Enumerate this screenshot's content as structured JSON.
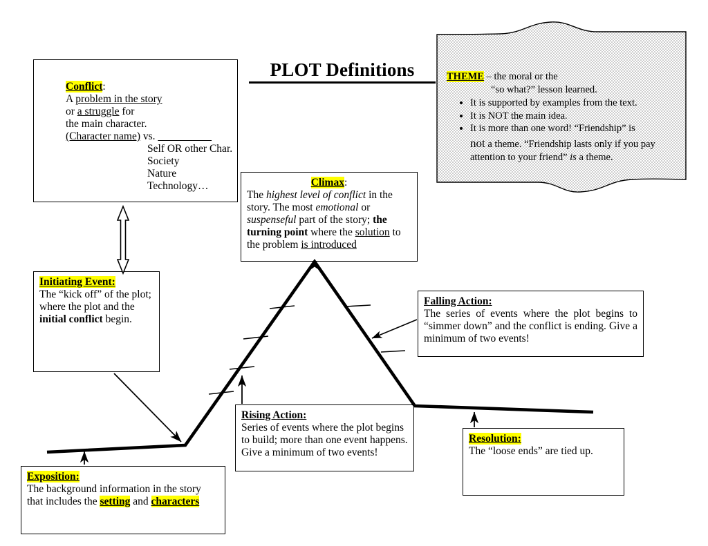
{
  "page": {
    "title": "PLOT Definitions"
  },
  "theme": {
    "label": "THEME",
    "line1_rest": " – the moral or the",
    "line2": "“so what?” lesson learned.",
    "bullets": [
      "It is supported by examples from the text.",
      "It is NOT the main idea.",
      "It is more than one word!   “Friendship” is"
    ],
    "tail_not": "not",
    "tail_a": " a theme. “Friendship lasts only if you pay",
    "tail_b": "attention to your friend” ",
    "tail_is": "is",
    "tail_c": " a theme.",
    "fill_color": "#d9d9d9"
  },
  "conflict": {
    "heading": "Conflict",
    "heading_colon": ":",
    "line1_a": "A ",
    "line1_b": "problem in the story",
    "line2_a": "or ",
    "line2_b": "a struggle",
    "line2_c": " for",
    "line3": "the main character.",
    "line4_a": "(Character name)",
    "line4_b": " vs. ",
    "line4_blank": "__________",
    "options": [
      "Self  OR other Char.",
      "Society",
      "Nature",
      "Technology…"
    ]
  },
  "climax": {
    "heading": "Climax",
    "heading_colon": ":",
    "t1": "The ",
    "t2": "highest level of conflict",
    "t3": " in the story. The most ",
    "t4": "emotional",
    "t5": " or ",
    "t6": "suspenseful",
    "t7": " part of the story; ",
    "t8": "the turning point",
    "t9": " where the ",
    "t10": "solution",
    "t11": " to the problem ",
    "t12": "is introduced"
  },
  "initiating": {
    "heading": "Initiating Event:",
    "t1": "The “kick off” of the plot; where the plot and the ",
    "t2": "initial conflict",
    "t3": " begin."
  },
  "falling": {
    "heading": "Falling Action:",
    "body": "The series of events where the plot begins to “simmer down” and the conflict is ending. Give a minimum of two events!"
  },
  "rising": {
    "heading": "Rising Action:",
    "body": "Series of events where the plot begins to build; more than one event happens. Give a minimum of two events!"
  },
  "resolution": {
    "heading": "Resolution:",
    "body": "The “loose ends” are tied up."
  },
  "exposition": {
    "heading": "Exposition:",
    "t1": "The background information in the story that includes the ",
    "t2": "setting",
    "t3": " and ",
    "t4": "characters"
  },
  "colors": {
    "highlight": "#FFFF00",
    "ink": "#000000",
    "theme_fill": "#d9d9d9"
  }
}
